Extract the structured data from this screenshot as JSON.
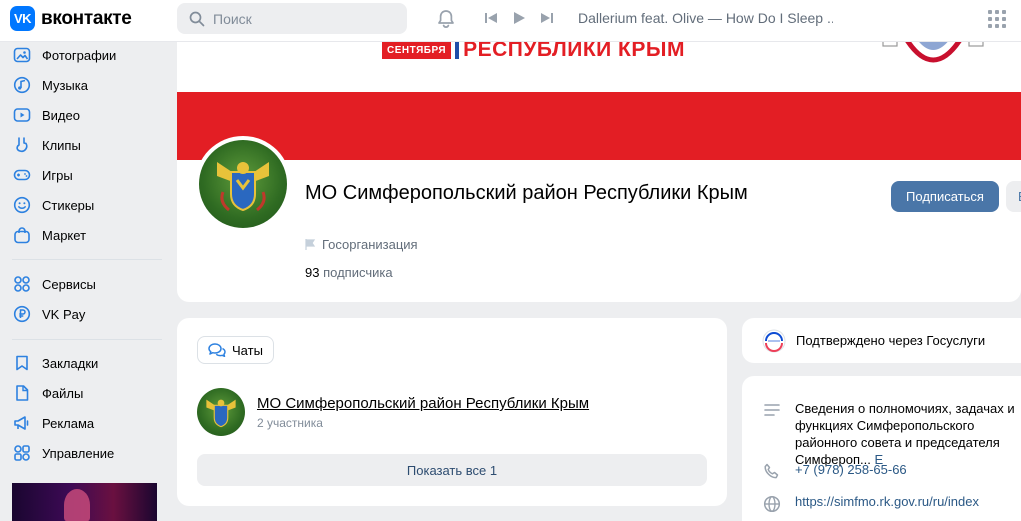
{
  "header": {
    "logo_badge": "VK",
    "logo_text": "вконтакте",
    "search_placeholder": "Поиск",
    "now_playing": "Dallerium feat. Olive — How Do I Sleep ..."
  },
  "sidebar": {
    "items": [
      {
        "label": "Фотографии",
        "icon": "photo-icon"
      },
      {
        "label": "Музыка",
        "icon": "music-icon"
      },
      {
        "label": "Видео",
        "icon": "video-icon"
      },
      {
        "label": "Клипы",
        "icon": "clips-icon"
      },
      {
        "label": "Игры",
        "icon": "gamepad-icon"
      },
      {
        "label": "Стикеры",
        "icon": "smile-icon"
      },
      {
        "label": "Маркет",
        "icon": "bag-icon"
      },
      {
        "label": "Сервисы",
        "icon": "services-icon"
      },
      {
        "label": "VK Pay",
        "icon": "rouble-icon"
      },
      {
        "label": "Закладки",
        "icon": "bookmark-icon"
      },
      {
        "label": "Файлы",
        "icon": "file-icon"
      },
      {
        "label": "Реклама",
        "icon": "megaphone-icon"
      },
      {
        "label": "Управление",
        "icon": "manage-icon"
      }
    ]
  },
  "cover": {
    "banner_small": "СЕНТЯБРЯ",
    "banner_text": "РЕСПУБЛИКИ КРЫМ"
  },
  "group": {
    "name": "МО Симферопольский район Республики Крым",
    "type": "Госорганизация",
    "subscribers_count": "93",
    "subscribers_label": "подписчика",
    "subscribe_button": "Подписаться",
    "more_button": "Е"
  },
  "chats": {
    "tab_label": "Чаты",
    "chat_title": "МО Симферопольский район Республики Крым",
    "chat_members": "2 участника",
    "show_all": "Показать все 1"
  },
  "info": {
    "verified": "Подтверждено через Госуслуги",
    "description": "Сведения о полномочиях, задачах и функциях Симферопольского районного совета и председателя Симфероп...",
    "description_more": "Е",
    "phone": "+7 (978) 258-65-66",
    "website": "https://simfmo.rk.gov.ru/ru/index"
  },
  "colors": {
    "accent": "#4a76a8",
    "brand": "#0077ff",
    "cover_red": "#e31e24",
    "icon_blue": "#2d81e0"
  }
}
